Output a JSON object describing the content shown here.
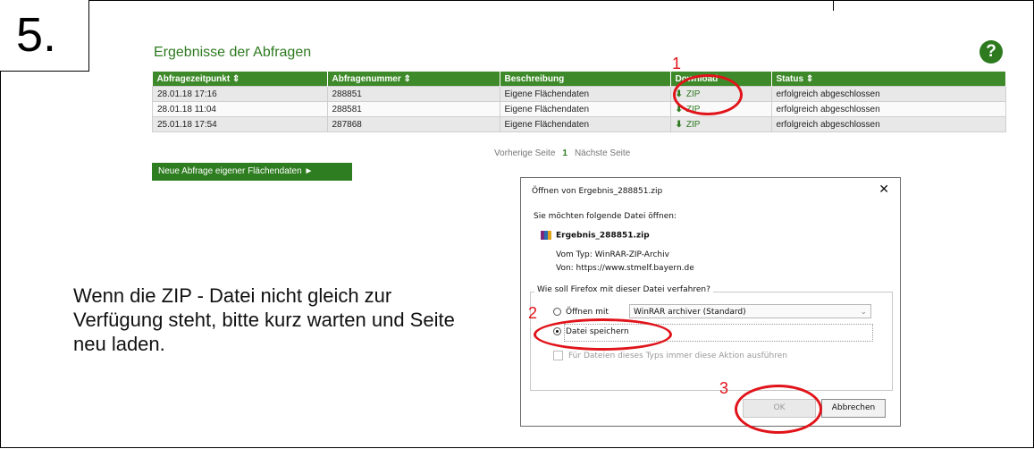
{
  "step": "5.",
  "section_title": "Ergebnisse der Abfragen",
  "help_icon": "?",
  "table": {
    "headers": [
      "Abfragezeitpunkt ⇕",
      "Abfragenummer ⇕",
      "Beschreibung",
      "Download",
      "Status ⇕"
    ],
    "rows": [
      {
        "time": "28.01.18 17:16",
        "number": "288851",
        "description": "Eigene Flächendaten",
        "download": "ZIP",
        "status": "erfolgreich abgeschlossen"
      },
      {
        "time": "28.01.18 11:04",
        "number": "288581",
        "description": "Eigene Flächendaten",
        "download": "ZIP",
        "status": "erfolgreich abgeschlossen"
      },
      {
        "time": "25.01.18 17:54",
        "number": "287868",
        "description": "Eigene Flächendaten",
        "download": "ZIP",
        "status": "erfolgreich abgeschlossen"
      }
    ]
  },
  "pager": {
    "prev": "Vorherige Seite",
    "current": "1",
    "next": "Nächste Seite"
  },
  "new_query_button": "Neue Abfrage eigener Flächendaten ►",
  "instruction": "Wenn die ZIP - Datei nicht gleich zur Verfügung steht, bitte kurz warten und Seite neu laden.",
  "dialog": {
    "title": "Öffnen von Ergebnis_288851.zip",
    "close": "✕",
    "question": "Sie möchten folgende Datei öffnen:",
    "filename": "Ergebnis_288851.zip",
    "type_line": "Vom Typ: WinRAR-ZIP-Archiv",
    "from_line": "Von: https://www.stmelf.bayern.de",
    "group_label": "Wie soll Firefox mit dieser Datei verfahren?",
    "open_with_label": "Öffnen mit",
    "open_with_value": "WinRAR archiver (Standard)",
    "save_label": "Datei speichern",
    "always_label": "Für Dateien dieses Typs immer diese Aktion ausführen",
    "ok": "OK",
    "cancel": "Abbrechen"
  },
  "annotations": [
    "1",
    "2",
    "3"
  ],
  "colors": {
    "accent_green": "#2d7a1f",
    "annotation_red": "#e0141a"
  }
}
